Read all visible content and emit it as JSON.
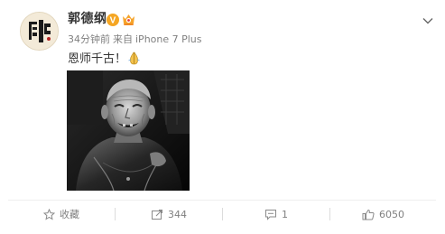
{
  "author": {
    "name": "郭德纲",
    "verified_badge": "V",
    "avatar_icon": "calligraphy-avatar"
  },
  "meta": {
    "time": "34分钟前",
    "source_prefix": "来自",
    "device": "iPhone 7 Plus"
  },
  "post": {
    "text": "恩师千古！",
    "emoji": "pray-icon"
  },
  "actions": {
    "favorite_label": "收藏",
    "repost_count": "344",
    "comment_count": "1",
    "like_count": "6050"
  },
  "colors": {
    "badge_orange": "#f5a623",
    "meta_gray": "#808080",
    "text": "#333333"
  }
}
